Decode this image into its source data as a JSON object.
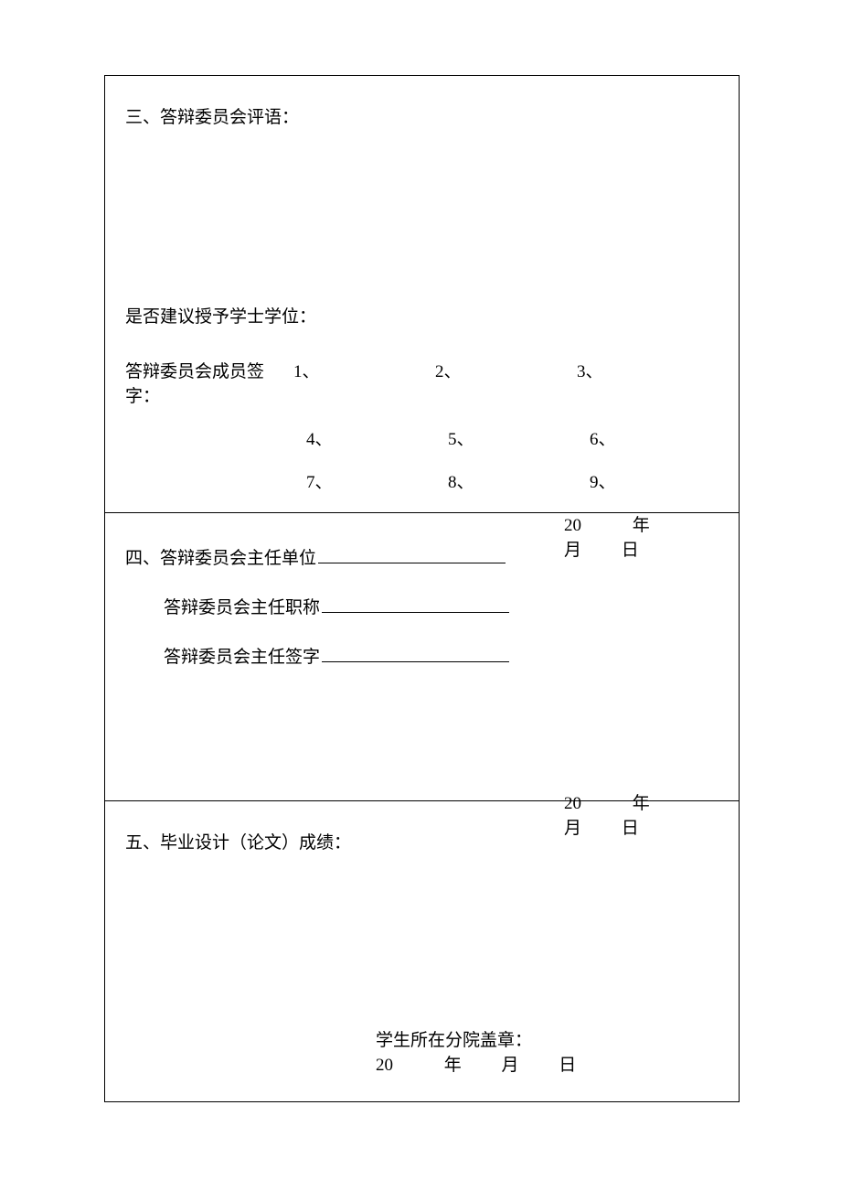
{
  "sections": {
    "s3": {
      "title": "三、答辩委员会评语：",
      "suggest": "是否建议授予学士学位：",
      "sign_label": "答辩委员会成员签字：",
      "slots_row1": [
        "1、",
        "2、",
        "3、"
      ],
      "slots_row2": [
        "4、",
        "5、",
        "6、"
      ],
      "slots_row3": [
        "7、",
        "8、",
        "9、"
      ],
      "date": {
        "prefix": "20",
        "y": "年",
        "m": "月",
        "d": "日"
      }
    },
    "s4": {
      "title_prefix": "四、",
      "unit_label": "答辩委员会主任单位",
      "rank_label": "答辩委员会主任职称",
      "sign_label": "答辩委员会主任签字",
      "date": {
        "prefix": "20",
        "y": "年",
        "m": "月",
        "d": "日"
      }
    },
    "s5": {
      "title": "五、毕业设计（论文）成绩：",
      "stamp_label": "学生所在分院盖章：",
      "date": {
        "prefix": "20",
        "y": "年",
        "m": "月",
        "d": "日"
      }
    }
  }
}
